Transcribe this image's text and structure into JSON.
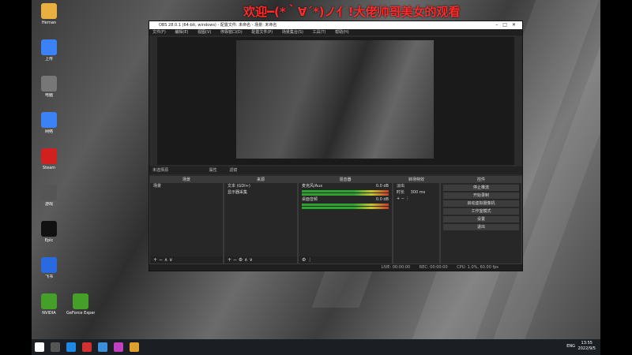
{
  "banner_text": "欢迎━(*｀∀´*)ノ亻!大佬帅哥美女的观看",
  "desktop_icons": [
    {
      "label": "Hernan",
      "color": "#e8b040"
    },
    {
      "label": "上传",
      "color": "#3b82f6"
    },
    {
      "label": "电脑",
      "color": "#777"
    },
    {
      "label": "网络",
      "color": "#3b82f6"
    },
    {
      "label": "Steam",
      "color": "#d02020"
    },
    {
      "label": "游戏",
      "color": "#555"
    },
    {
      "label": "Epic",
      "color": "#111"
    },
    {
      "label": "飞书",
      "color": "#2a6ae0"
    },
    {
      "label": "NVIDIA",
      "color": "#45a02a"
    },
    {
      "label": "GeForce Experience",
      "color": "#45a02a"
    }
  ],
  "obs": {
    "title": "OBS 28.0.1 (64-bit, windows) - 配置文件: 未命名 - 场景: 未命名",
    "menu": [
      "文件(F)",
      "编辑(E)",
      "视图(V)",
      "停靠窗口(D)",
      "配置文件(P)",
      "场景集合(S)",
      "工具(T)",
      "帮助(H)"
    ],
    "source_toolbar": [
      "未选择源",
      "属性",
      "滤镜"
    ],
    "docks": {
      "scenes": {
        "title": "场景",
        "items": [
          "场景"
        ]
      },
      "sources": {
        "title": "来源",
        "items": [
          "文本 (GDI+)",
          "显示器采集"
        ]
      },
      "mixer": {
        "title": "混音器",
        "channels": [
          {
            "name": "桌面音频",
            "level": "0.0 dB"
          },
          {
            "name": "麦克风/Aux",
            "level": "0.0 dB"
          }
        ]
      },
      "transitions": {
        "title": "转场特效",
        "type": "淡出",
        "duration_label": "时长",
        "duration_value": "300 ms"
      },
      "controls": {
        "title": "控件",
        "buttons": [
          "停止推流",
          "开始录制",
          "启动虚拟摄像机",
          "工作室模式",
          "设置",
          "退出"
        ]
      }
    },
    "status": {
      "live": "LIVE: 00:00:00",
      "rec": "REC: 00:00:00",
      "cpu": "CPU: 1.0%, 60.00 fps"
    }
  },
  "taskbar": {
    "lang": "ENG",
    "time": "13:55",
    "date": "2022/9/5"
  }
}
